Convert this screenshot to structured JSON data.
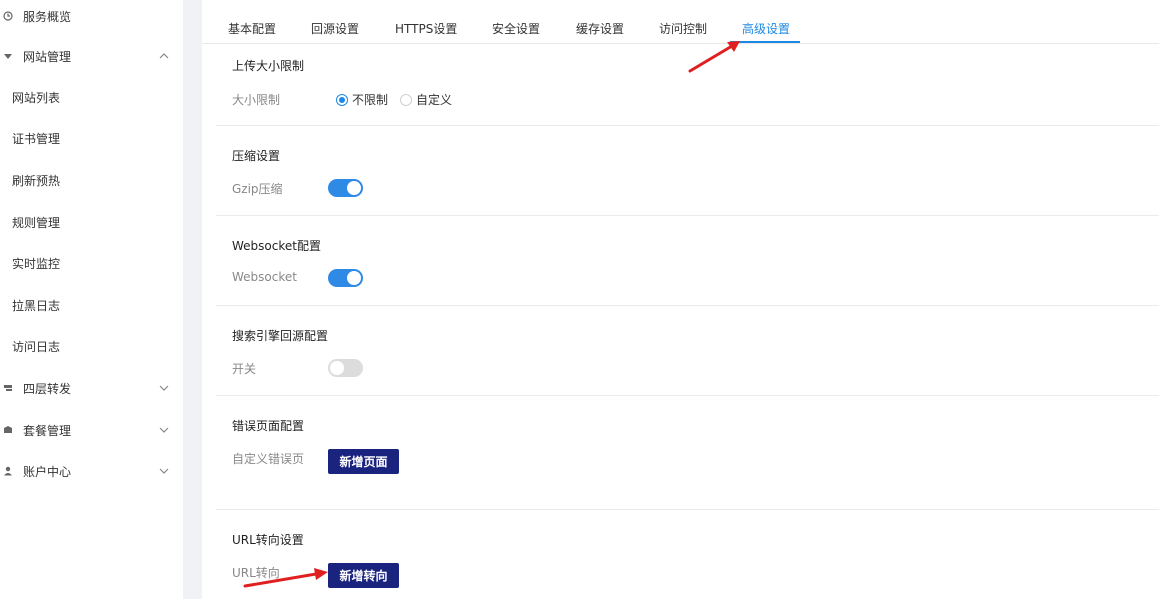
{
  "sidebar": {
    "items": [
      {
        "label": "服务概览",
        "icon": "clock-icon",
        "chevron": ""
      },
      {
        "label": "网站管理",
        "icon": "globe-icon",
        "chevron": "^"
      },
      {
        "label": "四层转发",
        "icon": "forward-icon",
        "chevron": "⌄"
      },
      {
        "label": "套餐管理",
        "icon": "package-icon",
        "chevron": "⌄"
      },
      {
        "label": "账户中心",
        "icon": "user-icon",
        "chevron": "⌄"
      }
    ],
    "sub_items": [
      {
        "label": "网站列表"
      },
      {
        "label": "证书管理"
      },
      {
        "label": "刷新预热"
      },
      {
        "label": "规则管理"
      },
      {
        "label": "实时监控"
      },
      {
        "label": "拉黑日志"
      },
      {
        "label": "访问日志"
      }
    ]
  },
  "tabs": [
    {
      "label": "基本配置"
    },
    {
      "label": "回源设置"
    },
    {
      "label": "HTTPS设置"
    },
    {
      "label": "安全设置"
    },
    {
      "label": "缓存设置"
    },
    {
      "label": "访问控制"
    },
    {
      "label": "高级设置"
    }
  ],
  "sections": {
    "upload": {
      "title": "上传大小限制",
      "label": "大小限制",
      "options": [
        "不限制",
        "自定义"
      ],
      "selected": "不限制"
    },
    "gzip": {
      "title": "压缩设置",
      "label": "Gzip压缩",
      "enabled": true
    },
    "websocket": {
      "title": "Websocket配置",
      "label": "Websocket",
      "enabled": true
    },
    "seo": {
      "title": "搜索引擎回源配置",
      "label": "开关",
      "enabled": false
    },
    "error_page": {
      "title": "错误页面配置",
      "label": "自定义错误页",
      "button": "新增页面"
    },
    "url_redirect": {
      "title": "URL转向设置",
      "label": "URL转向",
      "button": "新增转向"
    }
  },
  "colors": {
    "accent": "#1e88e5",
    "button": "#1a237e",
    "arrow": "#e02020"
  }
}
